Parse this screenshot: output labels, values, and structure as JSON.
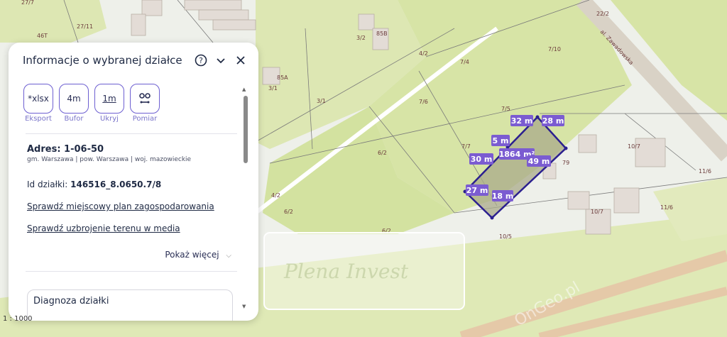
{
  "panel": {
    "title": "Informacje o wybranej działce",
    "tools": [
      {
        "icon_text": "*xlsx",
        "label": "Eksport"
      },
      {
        "icon_text": "4m",
        "label": "Bufor"
      },
      {
        "icon_text": "1m",
        "label": "Ukryj"
      },
      {
        "icon_text": "",
        "label": "Pomiar"
      }
    ],
    "address_title": "Adres: 1-06-50",
    "address_sub": "gm. Warszawa | pow. Warszawa | woj. mazowieckie",
    "parcel_id_label": "Id działki: ",
    "parcel_id_value": "146516_8.0650.7/8",
    "link_plan": "Sprawdź miejscowy plan zagospodarowania",
    "link_media": "Sprawdź uzbrojenie terenu w media",
    "show_more": "Pokaż więcej",
    "diagnosis_title": "Diagnoza działki"
  },
  "map": {
    "scale_text": "1 : 1000",
    "street_label": "al. Zawadowska",
    "watermark": "Plena Invest",
    "watermark2": "OnGeo.pl",
    "parcel_labels": [
      "27/7",
      "27/11",
      "46T",
      "3/2",
      "85B",
      "4/2",
      "7/4",
      "7/10",
      "22/2",
      "85A",
      "3/1",
      "3/1",
      "7/6",
      "7/5",
      "7/7",
      "6/2",
      "10/7",
      "11/6",
      "4/2",
      "6/2",
      "6/2",
      "11/6",
      "10/7",
      "10/5",
      "79"
    ],
    "measurements": [
      "32 m",
      "28 m",
      "5 m",
      "1864 m²",
      "30 m",
      "49 m",
      "27 m",
      "18 m"
    ],
    "colors": {
      "green": "#d7e4a6",
      "selection": "#2b1f8f",
      "label_bg": "#7b5cd1"
    }
  }
}
